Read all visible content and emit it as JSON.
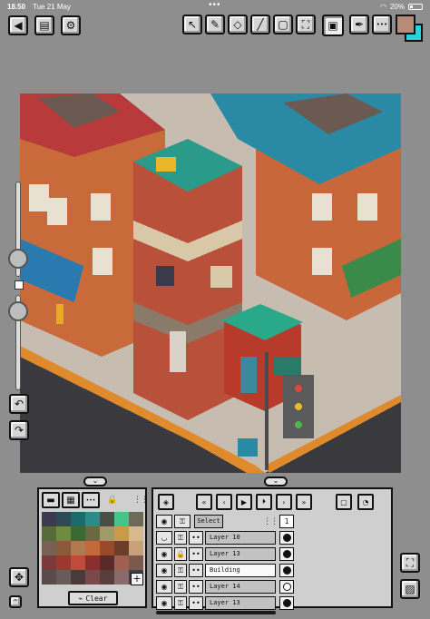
{
  "status_bar": {
    "time": "18.50",
    "date": "Tue 21 May",
    "battery": "20%"
  },
  "toolbar": {
    "left": [
      {
        "name": "back-icon",
        "glyph": "◀"
      },
      {
        "name": "export-icon",
        "glyph": "▤"
      },
      {
        "name": "settings-icon",
        "glyph": "⚙"
      }
    ],
    "tools": [
      {
        "name": "select-arrow-icon",
        "glyph": "↖"
      },
      {
        "name": "pencil-icon",
        "glyph": "✎"
      },
      {
        "name": "eraser-icon",
        "glyph": "◇"
      },
      {
        "name": "line-icon",
        "glyph": "╱"
      },
      {
        "name": "rectangle-icon",
        "glyph": "▢"
      },
      {
        "name": "fill-bucket-icon",
        "glyph": "⛶"
      },
      {
        "name": "stamp-icon",
        "glyph": "▣"
      },
      {
        "name": "eyedropper-icon",
        "glyph": "✒"
      },
      {
        "name": "more-icon",
        "glyph": "•••"
      }
    ],
    "primary_color": "#b88a78",
    "secondary_color": "#2ad1e0"
  },
  "side": {
    "undo_glyph": "↶",
    "redo_glyph": "↷",
    "move_glyph": "✥",
    "expand_glyph": "⌃"
  },
  "palette_panel": {
    "handle_glyph": "⌄",
    "buttons": [
      {
        "name": "folder-icon",
        "glyph": "▬"
      },
      {
        "name": "save-icon",
        "glyph": "▦"
      },
      {
        "name": "more-icon",
        "glyph": "•••"
      }
    ],
    "lock_glyph": "🔒",
    "add_glyph": "+",
    "clear_label": "Clear",
    "colors": [
      "#3b3a52",
      "#2e4a54",
      "#1d6a6c",
      "#2b8b86",
      "#4b4e45",
      "#46c48a",
      "#6e6a5a",
      "#556c3a",
      "#6e8b3f",
      "#3a6a34",
      "#6a6a42",
      "#a09a6a",
      "#c89a4a",
      "#d8b890",
      "#7a6050",
      "#8a5a3a",
      "#b07a50",
      "#c26a3a",
      "#9a4a2a",
      "#6a3e2a",
      "#c8a07a",
      "#7a3a3a",
      "#9a3a2e",
      "#c24a3a",
      "#8a2e2e",
      "#5a2a2a",
      "#a06050",
      "#7a5a4a",
      "#5a4a4a",
      "#6a5a5a",
      "#4a3a3a",
      "#7a4a4a",
      "#5a3e3e",
      "#8a6a6a",
      "#3e3e48"
    ]
  },
  "layers_panel": {
    "handle_glyph": "⌄",
    "toolbar_buttons": [
      {
        "name": "layer-settings-icon",
        "glyph": "◈"
      },
      {
        "name": "first-frame-icon",
        "glyph": "«"
      },
      {
        "name": "prev-frame-icon",
        "glyph": "‹"
      },
      {
        "name": "play-icon",
        "glyph": "▶"
      },
      {
        "name": "play-alt-icon",
        "glyph": "⏵"
      },
      {
        "name": "next-frame-icon",
        "glyph": "›"
      },
      {
        "name": "last-frame-icon",
        "glyph": "»"
      },
      {
        "name": "onion-skin-icon",
        "glyph": "▢"
      },
      {
        "name": "timer-icon",
        "glyph": "◔"
      }
    ],
    "select_label": "Select",
    "frame_count": "1",
    "layers": [
      {
        "name": "Layer 10",
        "active": false,
        "filled": true
      },
      {
        "name": "Layer 13",
        "active": false,
        "filled": true
      },
      {
        "name": "Building",
        "active": true,
        "filled": true
      },
      {
        "name": "Layer 14",
        "active": false,
        "filled": false
      },
      {
        "name": "Layer 13",
        "active": false,
        "filled": true
      }
    ]
  },
  "right_side": {
    "reference_glyph": "⛶",
    "image_glyph": "▨"
  }
}
